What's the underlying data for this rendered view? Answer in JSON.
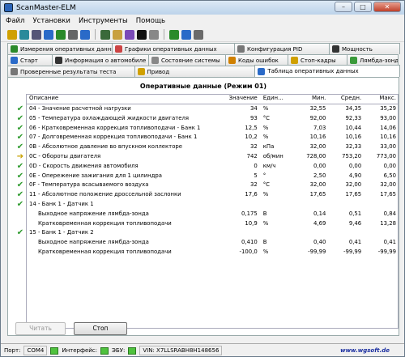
{
  "window": {
    "title": "ScanMaster-ELM",
    "min": "–",
    "max": "□",
    "close": "✕"
  },
  "menu": [
    "Файл",
    "Установки",
    "Инструменты",
    "Помощь"
  ],
  "tabs_row1": [
    {
      "label": "Измерения оперативных данных",
      "color": "#2a8a2a"
    },
    {
      "label": "Графики оперативных данных",
      "color": "#c44"
    },
    {
      "label": "Конфигурация PID",
      "color": "#777"
    },
    {
      "label": "Мощность",
      "color": "#333"
    }
  ],
  "tabs_row2": [
    {
      "label": "Старт",
      "color": "#2a6ac8"
    },
    {
      "label": "Информация о автомобиле",
      "color": "#333"
    },
    {
      "label": "Состояние системы",
      "color": "#888"
    },
    {
      "label": "Коды ошибок",
      "color": "#d08000"
    },
    {
      "label": "Стоп-кадры",
      "color": "#d0a000"
    },
    {
      "label": "Лямбда-зонды",
      "color": "#3a9a3a"
    }
  ],
  "tabs_row3": [
    {
      "label": "Проверенные результаты теста",
      "color": "#777"
    },
    {
      "label": "Привод",
      "color": "#d0a000"
    },
    {
      "label": "Таблица оперативных данных",
      "color": "#2a6ac8",
      "active": true
    }
  ],
  "panel_title": "Оперативные данные (Режим 01)",
  "columns": [
    "Описание",
    "Значение",
    "Един...",
    "Мин.",
    "Средн.",
    "Макс."
  ],
  "rows": [
    {
      "marker": "ok",
      "type": "item",
      "desc": "04 - Значение расчетной нагрузки",
      "value": "34",
      "unit": "%",
      "min": "32,55",
      "avg": "34,35",
      "max": "35,29"
    },
    {
      "marker": "ok",
      "type": "item",
      "desc": "05 - Температура охлаждающей жидкости двигателя",
      "value": "93",
      "unit": "°C",
      "min": "92,00",
      "avg": "92,33",
      "max": "93,00"
    },
    {
      "marker": "ok",
      "type": "item",
      "desc": "06 - Кратковременная коррекция топливоподачи - Банк 1",
      "value": "12,5",
      "unit": "%",
      "min": "7,03",
      "avg": "10,44",
      "max": "14,06"
    },
    {
      "marker": "ok",
      "type": "item",
      "desc": "07 - Долговременная коррекция топливоподачи - Банк 1",
      "value": "10,2",
      "unit": "%",
      "min": "10,16",
      "avg": "10,16",
      "max": "10,16"
    },
    {
      "marker": "ok",
      "type": "item",
      "desc": "0B - Абсолютное давление во впускном коллекторе",
      "value": "32",
      "unit": "кПа",
      "min": "32,00",
      "avg": "32,33",
      "max": "33,00"
    },
    {
      "marker": "arrow",
      "type": "item",
      "desc": "0C - Обороты двигателя",
      "value": "742",
      "unit": "об/мин",
      "min": "728,00",
      "avg": "753,20",
      "max": "773,00"
    },
    {
      "marker": "ok",
      "type": "item",
      "desc": "0D - Скорость движения автомобиля",
      "value": "0",
      "unit": "км/ч",
      "min": "0,00",
      "avg": "0,00",
      "max": "0,00"
    },
    {
      "marker": "ok",
      "type": "item",
      "desc": "0E - Опережение зажигания для 1 цилиндра",
      "value": "5",
      "unit": "°",
      "min": "2,50",
      "avg": "4,90",
      "max": "6,50"
    },
    {
      "marker": "ok",
      "type": "item",
      "desc": "0F - Температура всасываемого воздуха",
      "value": "32",
      "unit": "°C",
      "min": "32,00",
      "avg": "32,00",
      "max": "32,00"
    },
    {
      "marker": "ok",
      "type": "item",
      "desc": "11 - Абсолютное положение дроссельной заслонки",
      "value": "17,6",
      "unit": "%",
      "min": "17,65",
      "avg": "17,65",
      "max": "17,65"
    },
    {
      "marker": "ok",
      "type": "head",
      "desc": "14 - Банк 1 - Датчик 1",
      "value": "",
      "unit": "",
      "min": "",
      "avg": "",
      "max": ""
    },
    {
      "marker": "",
      "type": "sub",
      "desc": "Выходное напряжение лямбда-зонда",
      "value": "0,175",
      "unit": "В",
      "min": "0,14",
      "avg": "0,51",
      "max": "0,84"
    },
    {
      "marker": "",
      "type": "sub",
      "desc": "Кратковременная коррекция топливоподачи",
      "value": "10,9",
      "unit": "%",
      "min": "4,69",
      "avg": "9,46",
      "max": "13,28"
    },
    {
      "marker": "ok",
      "type": "head",
      "desc": "15 - Банк 1 - Датчик 2",
      "value": "",
      "unit": "",
      "min": "",
      "avg": "",
      "max": ""
    },
    {
      "marker": "",
      "type": "sub",
      "desc": "Выходное напряжение лямбда-зонда",
      "value": "0,410",
      "unit": "В",
      "min": "0,40",
      "avg": "0,41",
      "max": "0,41"
    },
    {
      "marker": "",
      "type": "sub",
      "desc": "Кратковременная коррекция топливоподачи",
      "value": "-100,0",
      "unit": "%",
      "min": "-99,99",
      "avg": "-99,99",
      "max": "-99,99"
    }
  ],
  "buttons": {
    "read": "Читать",
    "stop": "Стоп"
  },
  "status": {
    "port_label": "Порт:",
    "port_value": "COM4",
    "interface_label": "Интерфейс:",
    "ecu_label": "ЭБУ:",
    "vin": "VIN: X7LLSRABH8H148656",
    "url": "www.wgsoft.de"
  },
  "toolbar_icons": [
    {
      "name": "connect-icon",
      "color": "#d0a000"
    },
    {
      "name": "globe-icon",
      "color": "#2a8a9a"
    },
    {
      "name": "settings-icon",
      "color": "#557"
    },
    {
      "name": "table-icon",
      "color": "#2a6ac8"
    },
    {
      "name": "grid-icon",
      "color": "#2a8a2a"
    },
    {
      "name": "gauge-icon",
      "color": "#666"
    },
    {
      "name": "chart-icon",
      "color": "#2a6ac8"
    },
    {
      "name": "report-icon",
      "color": "#3a6a3a"
    },
    {
      "name": "clipboard-icon",
      "color": "#c8a040"
    },
    {
      "name": "trace-icon",
      "color": "#7a4ab8"
    },
    {
      "name": "terminal-icon",
      "color": "#111"
    },
    {
      "name": "camera-icon",
      "color": "#888"
    },
    {
      "name": "dtc-icon",
      "color": "#2a8a2a"
    },
    {
      "name": "help-icon",
      "color": "#2a6ac8"
    },
    {
      "name": "power-icon",
      "color": "#6a6a6a"
    }
  ]
}
